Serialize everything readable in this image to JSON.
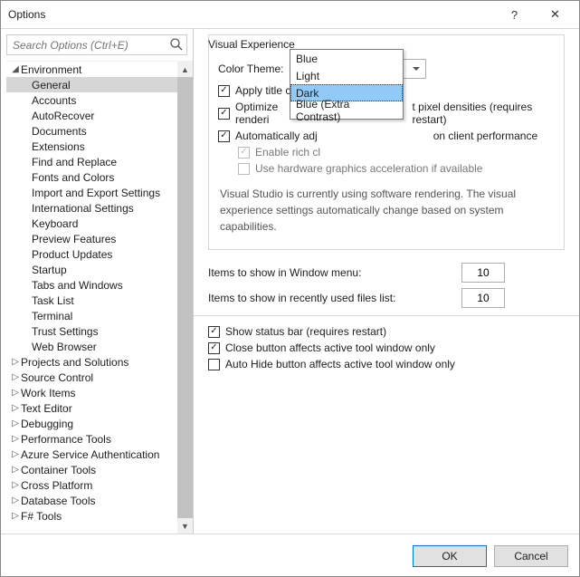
{
  "window": {
    "title": "Options",
    "help": "?",
    "close": "✕"
  },
  "search": {
    "placeholder": "Search Options (Ctrl+E)"
  },
  "tree": {
    "env": "Environment",
    "env_children": [
      "General",
      "Accounts",
      "AutoRecover",
      "Documents",
      "Extensions",
      "Find and Replace",
      "Fonts and Colors",
      "Import and Export Settings",
      "International Settings",
      "Keyboard",
      "Preview Features",
      "Product Updates",
      "Startup",
      "Tabs and Windows",
      "Task List",
      "Terminal",
      "Trust Settings",
      "Web Browser"
    ],
    "collapsed": [
      "Projects and Solutions",
      "Source Control",
      "Work Items",
      "Text Editor",
      "Debugging",
      "Performance Tools",
      "Azure Service Authentication",
      "Container Tools",
      "Cross Platform",
      "Database Tools",
      "F# Tools"
    ],
    "selected": "General"
  },
  "visual": {
    "group": "Visual Experience",
    "color_theme_label": "Color Theme:",
    "color_theme_value": "Blue",
    "options": [
      "Blue",
      "Light",
      "Dark",
      "Blue (Extra Contrast)"
    ],
    "highlight": "Dark",
    "apply_title_case": "Apply title case s",
    "optimize": "Optimize renderi",
    "optimize_tail": "t pixel densities (requires restart)",
    "auto_adjust": "Automatically adj",
    "auto_tail": "on client performance",
    "enable_rich": "Enable rich cl",
    "hw_accel": "Use hardware graphics acceleration if available",
    "info": "Visual Studio is currently using software rendering.  The visual experience settings automatically change based on system capabilities."
  },
  "items": {
    "window_menu": "Items to show in Window menu:",
    "window_menu_val": "10",
    "recent": "Items to show in recently used files list:",
    "recent_val": "10"
  },
  "status": {
    "show_status": "Show status bar (requires restart)",
    "close_btn": "Close button affects active tool window only",
    "autohide": "Auto Hide button affects active tool window only"
  },
  "footer": {
    "ok": "OK",
    "cancel": "Cancel"
  }
}
